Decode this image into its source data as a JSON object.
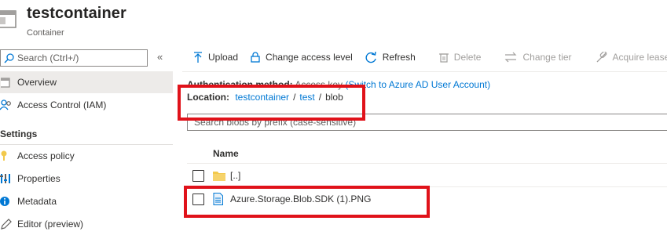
{
  "header": {
    "title": "testcontainer",
    "subtitle": "Container"
  },
  "sidebar": {
    "search_placeholder": "Search (Ctrl+/)",
    "collapse_glyph": "«",
    "items": [
      {
        "label": "Overview",
        "icon": "overview-icon",
        "active": true
      },
      {
        "label": "Access Control (IAM)",
        "icon": "people-icon"
      }
    ],
    "settings_heading": "Settings",
    "settings_items": [
      {
        "label": "Access policy",
        "icon": "key-icon"
      },
      {
        "label": "Properties",
        "icon": "properties-icon"
      },
      {
        "label": "Metadata",
        "icon": "info-icon"
      },
      {
        "label": "Editor (preview)",
        "icon": "pencil-icon"
      }
    ]
  },
  "toolbar": {
    "upload": "Upload",
    "change_access_level": "Change access level",
    "refresh": "Refresh",
    "delete": "Delete",
    "change_tier": "Change tier",
    "acquire_lease": "Acquire lease"
  },
  "auth": {
    "label": "Authentication method:",
    "value": "Access key",
    "link": "(Switch to Azure AD User Account)"
  },
  "location": {
    "label": "Location:",
    "crumbs": [
      "testcontainer",
      "test",
      "blob"
    ],
    "separator": "/"
  },
  "blob_search": {
    "placeholder": "Search blobs by prefix (case-sensitive)"
  },
  "table": {
    "column_name": "Name",
    "rows": [
      {
        "name": "[..]",
        "type": "folder"
      },
      {
        "name": "Azure.Storage.Blob.SDK (1).PNG",
        "type": "file"
      }
    ]
  },
  "colors": {
    "accent": "#0078d4",
    "highlight_box": "#e0121a",
    "folder": "#f2c94c"
  }
}
